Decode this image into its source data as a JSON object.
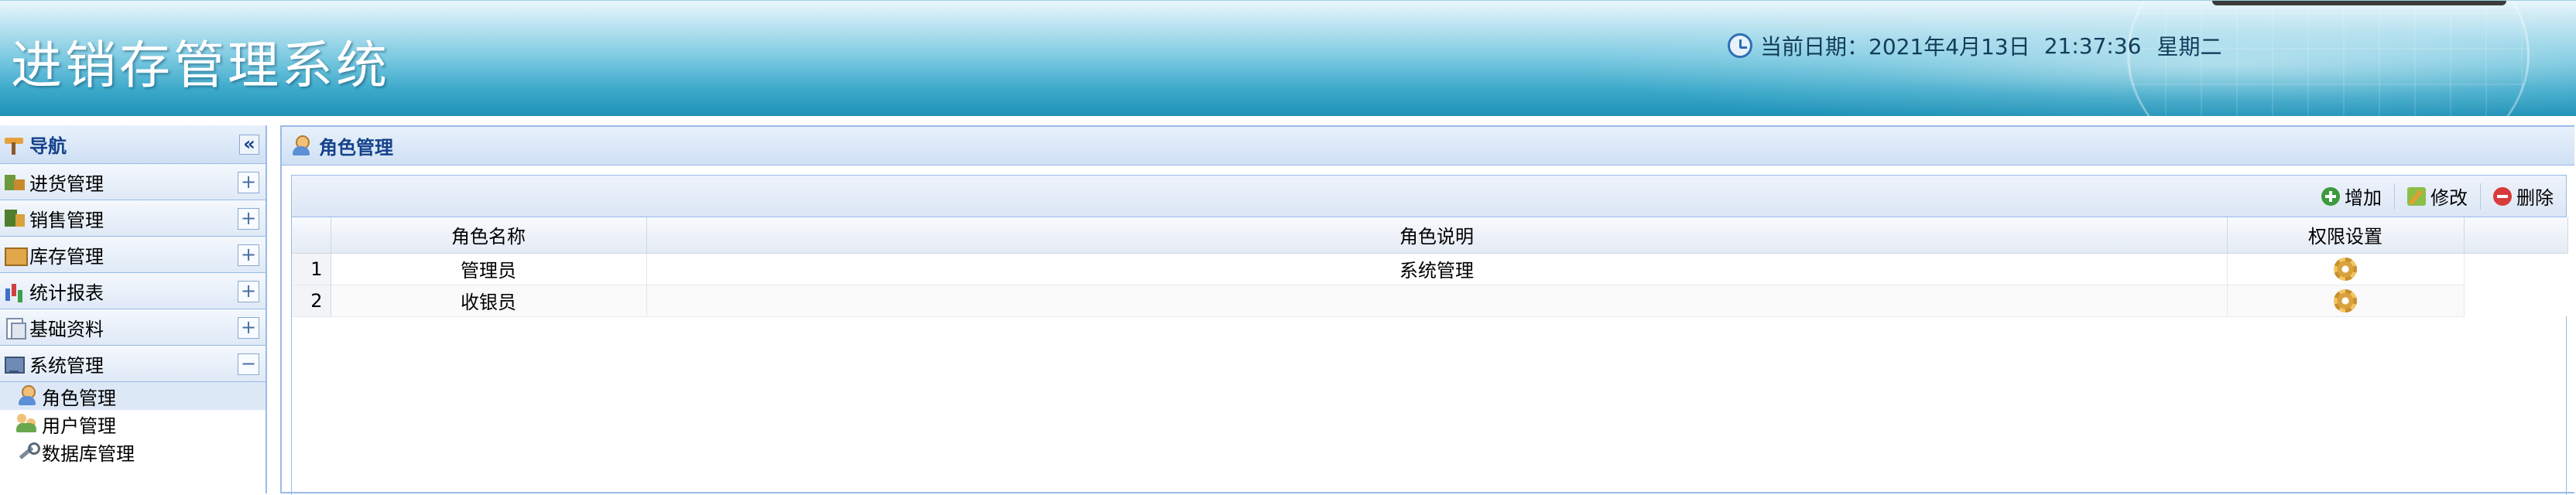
{
  "header": {
    "app_title": "进销存管理系统",
    "date_label": "当前日期：2021年4月13日",
    "time": "21:37:36",
    "weekday": "星期二"
  },
  "sidebar": {
    "title": "导航",
    "collapse_symbol": "«",
    "sections": [
      {
        "label": "进货管理",
        "icon": "purchase-icon",
        "toggle": "+"
      },
      {
        "label": "销售管理",
        "icon": "sales-icon",
        "toggle": "+"
      },
      {
        "label": "库存管理",
        "icon": "stock-icon",
        "toggle": "+"
      },
      {
        "label": "统计报表",
        "icon": "chart-icon",
        "toggle": "+"
      },
      {
        "label": "基础资料",
        "icon": "document-icon",
        "toggle": "+"
      },
      {
        "label": "系统管理",
        "icon": "computer-icon",
        "toggle": "−"
      }
    ],
    "system_items": [
      {
        "label": "角色管理",
        "icon": "role-icon",
        "active": true
      },
      {
        "label": "用户管理",
        "icon": "users-icon",
        "active": false
      },
      {
        "label": "数据库管理",
        "icon": "wrench-icon",
        "active": false
      }
    ]
  },
  "main": {
    "title": "角色管理",
    "toolbar": {
      "add_label": "增加",
      "edit_label": "修改",
      "delete_label": "删除"
    },
    "table": {
      "columns": [
        "角色名称",
        "角色说明",
        "权限设置"
      ],
      "rows": [
        {
          "num": "1",
          "name": "管理员",
          "desc": "系统管理",
          "perm_icon": "gear-icon"
        },
        {
          "num": "2",
          "name": "收银员",
          "desc": "",
          "perm_icon": "gear-icon"
        }
      ]
    }
  },
  "colors": {
    "panel_border": "#99bbe8",
    "panel_title": "#15428b",
    "header_blue": "#3aa8c9"
  }
}
